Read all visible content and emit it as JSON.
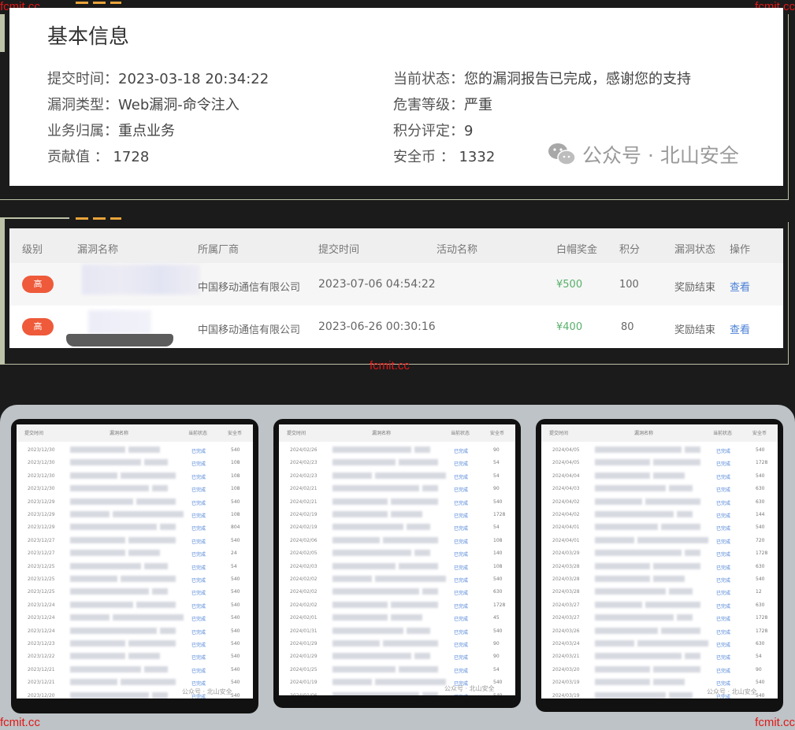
{
  "watermarks": {
    "top_left": "fcmit.cc",
    "top_right": "fcmit.cc",
    "middle": "fcmit.cc",
    "bottom_left": "fcmit.cc",
    "bottom_right": "fcmit.cc"
  },
  "basic_info": {
    "title": "基本信息",
    "submit_time_label": "提交时间：",
    "submit_time": "2023-03-18 20:34:22",
    "status_label": "当前状态：",
    "status": "您的漏洞报告已完成，感谢您的支持",
    "vuln_type_label": "漏洞类型：",
    "vuln_type": "Web漏洞-命令注入",
    "severity_label": "危害等级：",
    "severity": "严重",
    "business_label": "业务归属：",
    "business": "重点业务",
    "score_label": "积分评定：",
    "score": "9",
    "contribution_label": "贡献值 ：",
    "contribution": "1728",
    "coin_label": "安全币 ：",
    "coin": "1332",
    "wechat_watermark": "公众号 · 北山安全"
  },
  "vuln_table": {
    "headers": [
      "级别",
      "漏洞名称",
      "所属厂商",
      "提交时间",
      "活动名称",
      "白帽奖金",
      "积分",
      "漏洞状态",
      "操作"
    ],
    "rows": [
      {
        "level": "高",
        "vendor": "中国移动通信有限公司",
        "time": "2023-07-06 04:54:22",
        "reward": "¥500",
        "points": "100",
        "status": "奖励结束",
        "action": "查看"
      },
      {
        "level": "高",
        "vendor": "中国移动通信有限公司",
        "time": "2023-06-26 00:30:16",
        "reward": "¥400",
        "points": "80",
        "status": "奖励结束",
        "action": "查看"
      }
    ]
  },
  "screenshots": {
    "headers": [
      "提交时间",
      "漏洞名称",
      "当前状态",
      "安全币"
    ],
    "watermark": "公众号 · 北山安全",
    "panels": [
      {
        "rows": [
          {
            "date": "2023/12/30",
            "status": "已完成",
            "coin": "540"
          },
          {
            "date": "2023/12/30",
            "status": "已完成",
            "coin": "108"
          },
          {
            "date": "2023/12/30",
            "status": "已完成",
            "coin": "108"
          },
          {
            "date": "2023/12/30",
            "status": "已完成",
            "coin": "108"
          },
          {
            "date": "2023/12/29",
            "status": "已完成",
            "coin": "540"
          },
          {
            "date": "2023/12/29",
            "status": "已完成",
            "coin": "108"
          },
          {
            "date": "2023/12/29",
            "status": "已完成",
            "coin": "804"
          },
          {
            "date": "2023/12/27",
            "status": "已完成",
            "coin": "540"
          },
          {
            "date": "2023/12/27",
            "status": "已完成",
            "coin": "24"
          },
          {
            "date": "2023/12/25",
            "status": "已完成",
            "coin": "54"
          },
          {
            "date": "2023/12/25",
            "status": "已完成",
            "coin": "540"
          },
          {
            "date": "2023/12/25",
            "status": "已完成",
            "coin": "540"
          },
          {
            "date": "2023/12/24",
            "status": "已完成",
            "coin": "540"
          },
          {
            "date": "2023/12/24",
            "status": "已完成",
            "coin": "540"
          },
          {
            "date": "2023/12/24",
            "status": "已完成",
            "coin": "540"
          },
          {
            "date": "2023/12/23",
            "status": "已完成",
            "coin": "540"
          },
          {
            "date": "2023/12/22",
            "status": "已完成",
            "coin": "540"
          },
          {
            "date": "2023/12/21",
            "status": "已完成",
            "coin": "540"
          },
          {
            "date": "2023/12/21",
            "status": "已完成",
            "coin": "540"
          },
          {
            "date": "2023/12/20",
            "status": "已完成",
            "coin": "540"
          }
        ]
      },
      {
        "rows": [
          {
            "date": "2024/02/26",
            "status": "已完成",
            "coin": "90"
          },
          {
            "date": "2024/02/23",
            "status": "已完成",
            "coin": "54"
          },
          {
            "date": "2024/02/23",
            "status": "已完成",
            "coin": "54"
          },
          {
            "date": "2024/02/21",
            "status": "已完成",
            "coin": "90"
          },
          {
            "date": "2024/02/21",
            "status": "已完成",
            "coin": "540"
          },
          {
            "date": "2024/02/19",
            "status": "已完成",
            "coin": "1728"
          },
          {
            "date": "2024/02/19",
            "status": "已完成",
            "coin": "54"
          },
          {
            "date": "2024/02/06",
            "status": "已完成",
            "coin": "108"
          },
          {
            "date": "2024/02/05",
            "status": "已完成",
            "coin": "140"
          },
          {
            "date": "2024/02/03",
            "status": "已完成",
            "coin": "108"
          },
          {
            "date": "2024/02/02",
            "status": "已完成",
            "coin": "540"
          },
          {
            "date": "2024/02/02",
            "status": "已完成",
            "coin": "630"
          },
          {
            "date": "2024/02/02",
            "status": "已完成",
            "coin": "1728"
          },
          {
            "date": "2024/02/01",
            "status": "已完成",
            "coin": "45"
          },
          {
            "date": "2024/01/31",
            "status": "已完成",
            "coin": "540"
          },
          {
            "date": "2024/01/29",
            "status": "已完成",
            "coin": "90"
          },
          {
            "date": "2024/01/29",
            "status": "已完成",
            "coin": "90"
          },
          {
            "date": "2024/01/25",
            "status": "已完成",
            "coin": "54"
          },
          {
            "date": "2024/01/19",
            "status": "已完成",
            "coin": "540"
          },
          {
            "date": "2024/01/06",
            "status": "已完成",
            "coin": "540"
          }
        ]
      },
      {
        "rows": [
          {
            "date": "2024/04/05",
            "status": "已完成",
            "coin": "540"
          },
          {
            "date": "2024/04/05",
            "status": "已完成",
            "coin": "1728"
          },
          {
            "date": "2024/04/04",
            "status": "已完成",
            "coin": "540"
          },
          {
            "date": "2024/04/03",
            "status": "已完成",
            "coin": "630"
          },
          {
            "date": "2024/04/02",
            "status": "已完成",
            "coin": "630"
          },
          {
            "date": "2024/04/02",
            "status": "已完成",
            "coin": "144"
          },
          {
            "date": "2024/04/01",
            "status": "已完成",
            "coin": "540"
          },
          {
            "date": "2024/04/01",
            "status": "已完成",
            "coin": "720"
          },
          {
            "date": "2024/03/29",
            "status": "已完成",
            "coin": "1728"
          },
          {
            "date": "2024/03/28",
            "status": "已完成",
            "coin": "630"
          },
          {
            "date": "2024/03/28",
            "status": "已完成",
            "coin": "540"
          },
          {
            "date": "2024/03/28",
            "status": "已完成",
            "coin": "12"
          },
          {
            "date": "2024/03/27",
            "status": "已完成",
            "coin": "630"
          },
          {
            "date": "2024/03/27",
            "status": "已完成",
            "coin": "1728"
          },
          {
            "date": "2024/03/26",
            "status": "已完成",
            "coin": "1728"
          },
          {
            "date": "2024/03/24",
            "status": "已完成",
            "coin": "630"
          },
          {
            "date": "2024/03/21",
            "status": "已完成",
            "coin": "54"
          },
          {
            "date": "2024/03/20",
            "status": "已完成",
            "coin": "90"
          },
          {
            "date": "2024/03/19",
            "status": "已完成",
            "coin": "540"
          },
          {
            "date": "2024/03/19",
            "status": "已完成",
            "coin": "540"
          }
        ]
      }
    ]
  }
}
